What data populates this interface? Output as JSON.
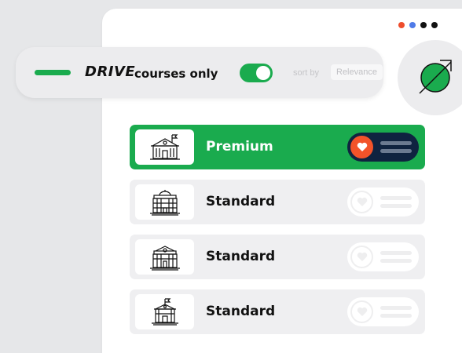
{
  "colors": {
    "brand_green": "#1aab4e",
    "navy": "#0f2340",
    "heart_orange": "#f2532a",
    "dot_red": "#ee4d2d",
    "dot_blue": "#4f7be8",
    "dot_black": "#111111"
  },
  "window": {
    "dots": [
      "red",
      "blue",
      "black",
      "black"
    ]
  },
  "filter": {
    "brand": "DRIVE",
    "courses_label": "courses only",
    "courses_only_enabled": true,
    "sort_label": "sort by",
    "sort_value": "Relevance"
  },
  "action_button": {
    "icon": "green-circle-arrow-icon"
  },
  "rows": [
    {
      "label": "Premium",
      "icon": "school-building-flag-icon",
      "active": true,
      "favorite": true
    },
    {
      "label": "Standard",
      "icon": "government-building-icon",
      "active": false,
      "favorite": false
    },
    {
      "label": "Standard",
      "icon": "institute-building-icon",
      "active": false,
      "favorite": false
    },
    {
      "label": "Standard",
      "icon": "school-building-flag-icon",
      "active": false,
      "favorite": false
    }
  ]
}
